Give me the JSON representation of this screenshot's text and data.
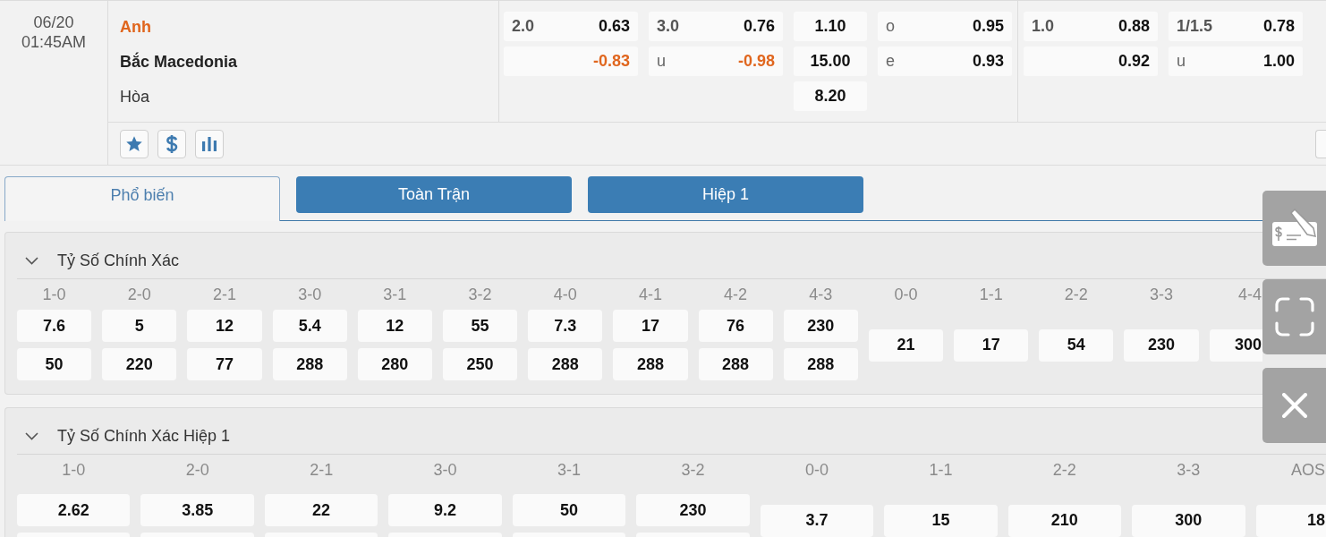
{
  "match": {
    "date": "06/20",
    "time": "01:45AM",
    "teams": [
      {
        "name": "Anh",
        "kind": "home"
      },
      {
        "name": "Bắc Macedonia",
        "kind": "away"
      },
      {
        "name": "Hòa",
        "kind": "draw"
      }
    ]
  },
  "odds_groups": [
    {
      "markets": [
        {
          "kind": "handicap",
          "cells": [
            {
              "line": "2.0",
              "price": "0.63",
              "negative": false
            },
            {
              "price": "-0.83",
              "negative": true
            }
          ]
        },
        {
          "kind": "total",
          "cells": [
            {
              "line": "3.0",
              "price": "0.76",
              "negative": false
            },
            {
              "side": "u",
              "price": "-0.98",
              "negative": true
            }
          ]
        },
        {
          "kind": "moneyline",
          "cells": [
            {
              "price": "1.10",
              "negative": false
            },
            {
              "price": "15.00",
              "negative": false
            },
            {
              "price": "8.20",
              "negative": false
            }
          ]
        },
        {
          "kind": "parity",
          "cells": [
            {
              "side": "o",
              "price": "0.95",
              "negative": false
            },
            {
              "side": "e",
              "price": "0.93",
              "negative": false
            }
          ]
        }
      ]
    },
    {
      "markets": [
        {
          "kind": "handicap",
          "cells": [
            {
              "line": "1.0",
              "price": "0.88",
              "negative": false
            },
            {
              "price": "0.92",
              "negative": false
            }
          ]
        },
        {
          "kind": "total",
          "cells": [
            {
              "line": "1/1.5",
              "price": "0.78",
              "negative": false
            },
            {
              "side": "u",
              "price": "1.00",
              "negative": false
            }
          ]
        }
      ]
    }
  ],
  "tabs": [
    {
      "label": "Phổ biến",
      "selected": true
    },
    {
      "label": "Toàn Trận",
      "selected": false
    },
    {
      "label": "Hiệp 1",
      "selected": false
    }
  ],
  "sections": [
    {
      "title": "Tỷ Số Chính Xác",
      "expanded": true,
      "columns": [
        {
          "kind": "win",
          "label": "1-0",
          "values": [
            "7.6",
            "50"
          ]
        },
        {
          "kind": "win",
          "label": "2-0",
          "values": [
            "5",
            "220"
          ]
        },
        {
          "kind": "win",
          "label": "2-1",
          "values": [
            "12",
            "77"
          ]
        },
        {
          "kind": "win",
          "label": "3-0",
          "values": [
            "5.4",
            "288"
          ]
        },
        {
          "kind": "win",
          "label": "3-1",
          "values": [
            "12",
            "280"
          ]
        },
        {
          "kind": "win",
          "label": "3-2",
          "values": [
            "55",
            "250"
          ]
        },
        {
          "kind": "win",
          "label": "4-0",
          "values": [
            "7.3",
            "288"
          ]
        },
        {
          "kind": "win",
          "label": "4-1",
          "values": [
            "17",
            "288"
          ]
        },
        {
          "kind": "win",
          "label": "4-2",
          "values": [
            "76",
            "288"
          ]
        },
        {
          "kind": "win",
          "label": "4-3",
          "values": [
            "230",
            "288"
          ]
        },
        {
          "kind": "draw",
          "label": "0-0",
          "values": [
            "21"
          ]
        },
        {
          "kind": "draw",
          "label": "1-1",
          "values": [
            "17"
          ]
        },
        {
          "kind": "draw",
          "label": "2-2",
          "values": [
            "54"
          ]
        },
        {
          "kind": "draw",
          "label": "3-3",
          "values": [
            "230"
          ]
        },
        {
          "kind": "draw",
          "label": "4-4",
          "values": [
            "300"
          ]
        }
      ]
    },
    {
      "title": "Tỷ Số Chính Xác Hiệp 1",
      "expanded": true,
      "columns": [
        {
          "kind": "win",
          "label": "1-0",
          "values": [
            "2.62"
          ]
        },
        {
          "kind": "win",
          "label": "2-0",
          "values": [
            "3.85"
          ]
        },
        {
          "kind": "win",
          "label": "2-1",
          "values": [
            "22"
          ]
        },
        {
          "kind": "win",
          "label": "3-0",
          "values": [
            "9.2"
          ]
        },
        {
          "kind": "win",
          "label": "3-1",
          "values": [
            "50"
          ]
        },
        {
          "kind": "win",
          "label": "3-2",
          "values": [
            "230"
          ]
        },
        {
          "kind": "draw",
          "label": "0-0",
          "values": [
            "3.7"
          ]
        },
        {
          "kind": "draw",
          "label": "1-1",
          "values": [
            "15"
          ]
        },
        {
          "kind": "draw",
          "label": "2-2",
          "values": [
            "210"
          ]
        },
        {
          "kind": "draw",
          "label": "3-3",
          "values": [
            "300"
          ]
        },
        {
          "kind": "draw",
          "label": "AOS",
          "values": [
            "18"
          ]
        }
      ]
    }
  ]
}
